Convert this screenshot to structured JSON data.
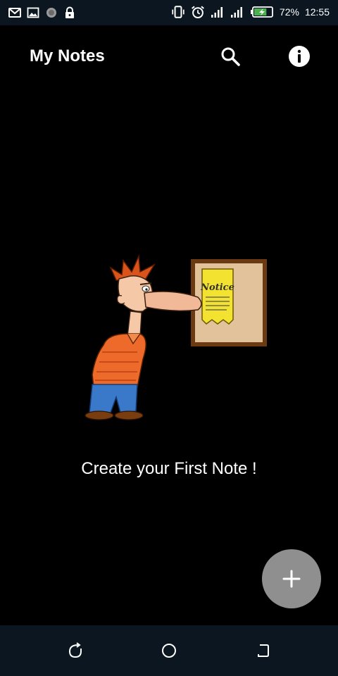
{
  "status_bar": {
    "battery_percent": "72%",
    "time": "12:55",
    "battery_level": 0.72,
    "icons_left": [
      "gmail-icon",
      "gallery-icon",
      "sync-icon",
      "lock-icon"
    ],
    "icons_right": [
      "vibrate-icon",
      "alarm-icon",
      "signal-icon",
      "signal-icon",
      "battery-charging-icon"
    ]
  },
  "app_bar": {
    "title": "My Notes",
    "actions": [
      "search-icon",
      "info-icon"
    ]
  },
  "main": {
    "empty_message": "Create your First Note !",
    "illustration_sign_text": "Notice"
  },
  "fab": {
    "icon": "plus-icon"
  },
  "nav_bar": {
    "buttons": [
      "back-icon",
      "home-icon",
      "recent-apps-icon"
    ]
  },
  "colors": {
    "background": "#000000",
    "status_bar": "#0b1620",
    "fab": "#8f8f8f",
    "text": "#ffffff"
  }
}
